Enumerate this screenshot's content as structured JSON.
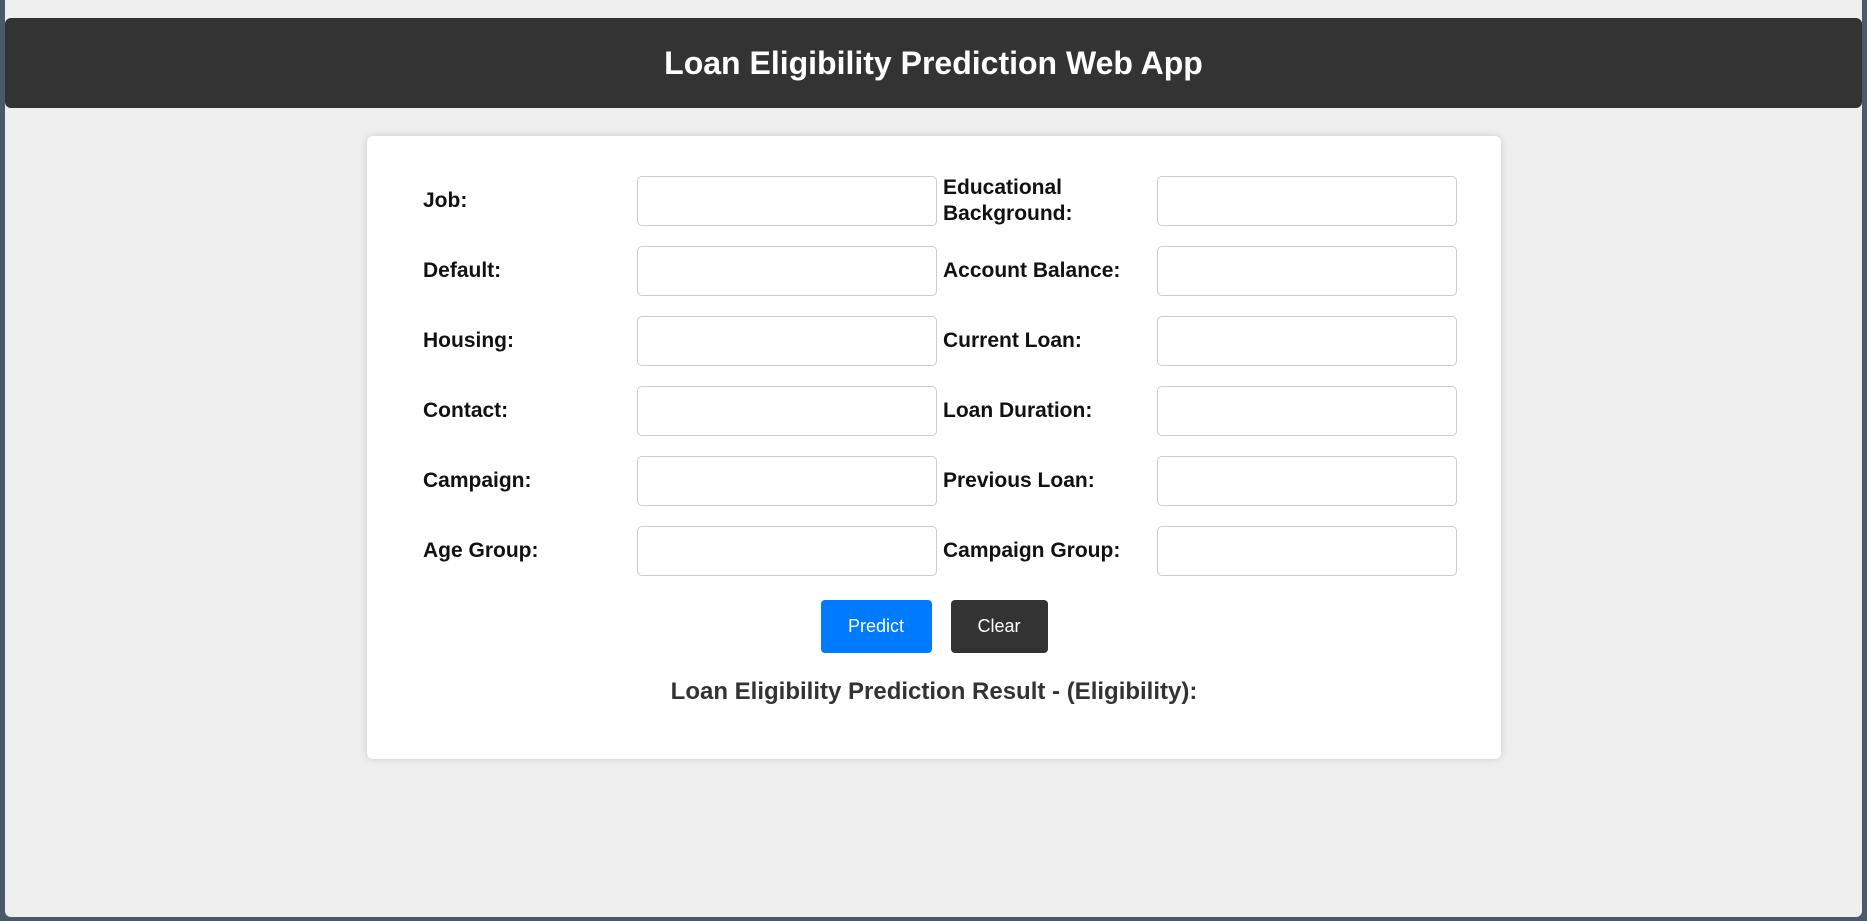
{
  "header": {
    "title": "Loan Eligibility Prediction Web App"
  },
  "form": {
    "fields": [
      {
        "label": "Job:",
        "value": ""
      },
      {
        "label": "Educational Background:",
        "value": ""
      },
      {
        "label": "Default:",
        "value": ""
      },
      {
        "label": "Account Balance:",
        "value": ""
      },
      {
        "label": "Housing:",
        "value": ""
      },
      {
        "label": "Current Loan:",
        "value": ""
      },
      {
        "label": "Contact:",
        "value": ""
      },
      {
        "label": "Loan Duration:",
        "value": ""
      },
      {
        "label": "Campaign:",
        "value": ""
      },
      {
        "label": "Previous Loan:",
        "value": ""
      },
      {
        "label": "Age Group:",
        "value": ""
      },
      {
        "label": "Campaign Group:",
        "value": ""
      }
    ],
    "predict_label": "Predict",
    "clear_label": "Clear"
  },
  "result": {
    "label": "Loan Eligibility Prediction Result - (Eligibility):"
  },
  "colors": {
    "header_bg": "#333333",
    "predict_bg": "#007bff",
    "clear_bg": "#333333",
    "page_bg": "#efefef"
  }
}
